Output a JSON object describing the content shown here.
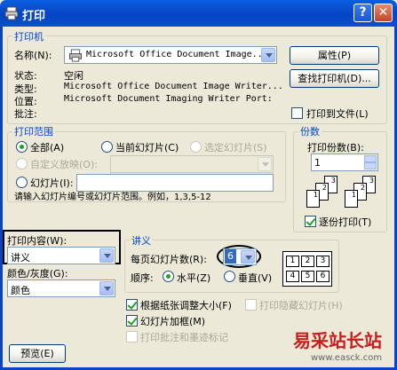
{
  "window": {
    "title": "打印",
    "help": "?",
    "close": "✕"
  },
  "printer": {
    "legend": "打印机",
    "name_label": "名称(N):",
    "name_value": "Microsoft Office Document Image...",
    "properties": "属性(P)",
    "find_printer": "查找打印机(D)...",
    "status_label": "状态:",
    "status_value": "空闲",
    "type_label": "类型:",
    "type_value": "Microsoft Office Document Image Writer...",
    "location_label": "位置:",
    "location_value": "Microsoft Document Imaging Writer Port:",
    "comment_label": "批注:",
    "print_to_file": "打印到文件(L)"
  },
  "range": {
    "legend": "打印范围",
    "all": "全部(A)",
    "current": "当前幻灯片(C)",
    "selected": "选定幻灯片(S)",
    "custom_show": "自定义放映(O):",
    "slides": "幻灯片(I):",
    "hint": "请输入幻灯片编号或幻灯片范围。例如，1,3,5-12"
  },
  "copies": {
    "legend": "份数",
    "count_label": "打印份数(B):",
    "count_value": "1",
    "collate": "逐份打印(T)",
    "pages": [
      "1",
      "2",
      "3"
    ]
  },
  "print_what": {
    "label": "打印内容(W):",
    "value": "讲义"
  },
  "color": {
    "label": "颜色/灰度(G):",
    "value": "颜色"
  },
  "handouts": {
    "legend": "讲义",
    "per_page_label": "每页幻灯片数(R):",
    "per_page_value": "6",
    "order_label": "顺序:",
    "horizontal": "水平(Z)",
    "vertical": "垂直(V)",
    "layout_cells": [
      "1",
      "2",
      "3",
      "4",
      "5",
      "6"
    ]
  },
  "options": {
    "scale": "根据纸张调整大小(F)",
    "frame": "幻灯片加框(M)",
    "comments": "打印批注和墨迹标记",
    "hidden": "打印隐藏幻灯片(H)"
  },
  "footer": {
    "preview": "预览(E)"
  },
  "watermark": {
    "cn": "易采站长站",
    "en": "www.easck.com"
  }
}
